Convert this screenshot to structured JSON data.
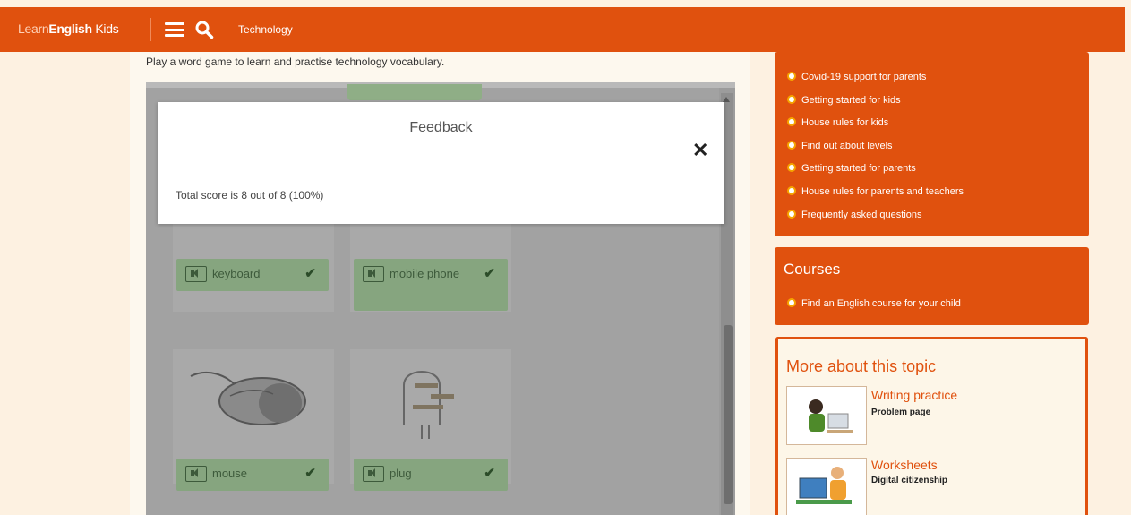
{
  "header": {
    "logo_learn": "Learn",
    "logo_english": "English",
    "logo_kids": " Kids",
    "breadcrumb": "Technology",
    "menu_icon": "hamburger-menu-icon",
    "search_icon": "search-icon"
  },
  "main": {
    "intro": "Play a word game to learn and practise technology vocabulary.",
    "cards": [
      {
        "word": "keyboard"
      },
      {
        "word": "mobile phone"
      },
      {
        "word": "mouse"
      },
      {
        "word": "plug"
      }
    ]
  },
  "modal": {
    "title": "Feedback",
    "close": "✕",
    "score": "Total score is 8 out of 8 (100%)"
  },
  "sidebar": {
    "links": [
      "Covid-19 support for parents",
      "Getting started for kids",
      "House rules for kids",
      "Find out about levels",
      "Getting started for parents",
      "House rules for parents and teachers",
      "Frequently asked questions"
    ],
    "courses": {
      "title": "Courses",
      "item": "Find an English course for your child"
    },
    "more": {
      "title": "More about this topic",
      "resources": [
        {
          "title": "Writing practice",
          "subtitle": "Problem page"
        },
        {
          "title": "Worksheets",
          "subtitle": "Digital citizenship"
        }
      ]
    }
  },
  "colors": {
    "brand": "#e0510e",
    "bullet": "#f6a400",
    "correct_green": "#86a57f"
  }
}
